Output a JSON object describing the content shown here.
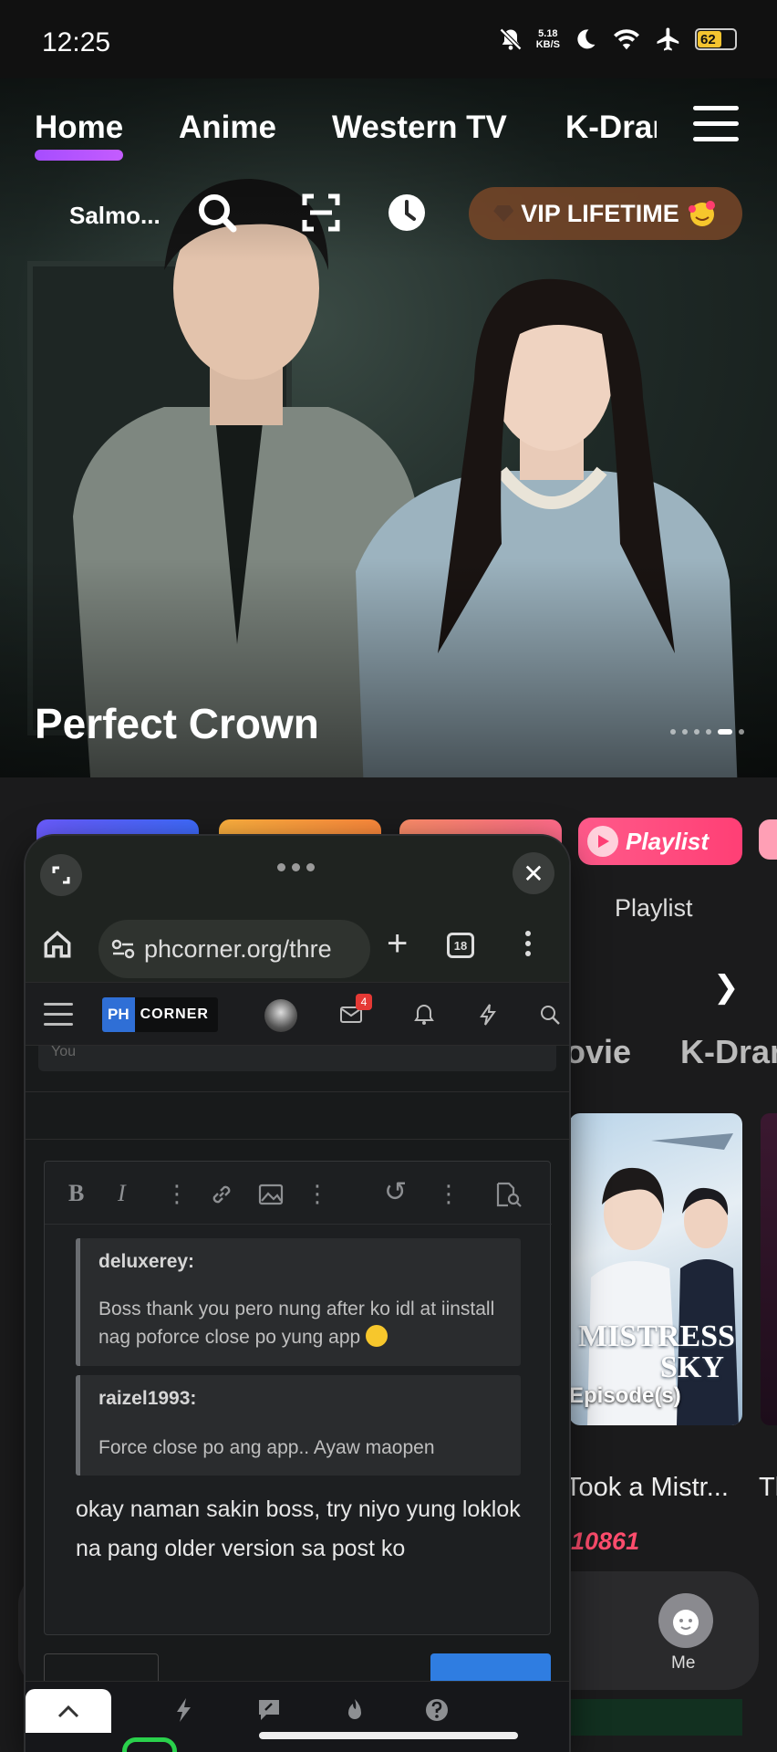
{
  "status_bar": {
    "time": "12:25",
    "net_speed_value": "5.18",
    "net_speed_unit": "KB/S",
    "battery": "62",
    "icons": [
      "mute-bell-icon",
      "moon-icon",
      "wifi-icon",
      "airplane-icon",
      "battery-icon"
    ]
  },
  "top_nav": {
    "tabs": [
      {
        "label": "Home",
        "active": true
      },
      {
        "label": "Anime",
        "active": false
      },
      {
        "label": "Western TV",
        "active": false
      },
      {
        "label": "K-Drama",
        "active": false
      }
    ]
  },
  "toolbar": {
    "search_label": "Salmo...",
    "vip_label": "VIP LIFETIME"
  },
  "hero": {
    "title": "Perfect Crown",
    "carousel_total": 6,
    "carousel_active": 5
  },
  "categories": {
    "playlist_pill": "Playlist",
    "playlist_label": "Playlist"
  },
  "section_tabs": [
    "ovie",
    "K-Dran"
  ],
  "card": {
    "poster_text_line1": "MISTRESS",
    "poster_text_line2": "SKY",
    "episodes": "Episode(s)",
    "title": "Took a Mistr...",
    "title_next": "Th",
    "heat": "10861"
  },
  "bottom_nav": {
    "me_label": "Me"
  },
  "browser": {
    "url": "phcorner.org/thre",
    "tab_count": "18",
    "site_logo_left": "PH",
    "site_logo_right": "CORNER",
    "inbox_badge": "4",
    "post_fragment": "You",
    "quotes": [
      {
        "user": "deluxerey:",
        "text": "Boss thank you pero nung after ko idl at iinstall nag poforce close po yung app"
      },
      {
        "user": "raizel1993:",
        "text": "Force close po ang app.. Ayaw maopen"
      }
    ],
    "reply": "okay naman sakin boss, try niyo yung loklok na pang older version sa post ko"
  },
  "colors": {
    "accent_purple": "#a64dff",
    "vip_bg": "#784628",
    "playlist_pink": "#ff3f75",
    "heat_red": "#ff4d6d",
    "phcorner_blue": "#2f6fd6"
  }
}
